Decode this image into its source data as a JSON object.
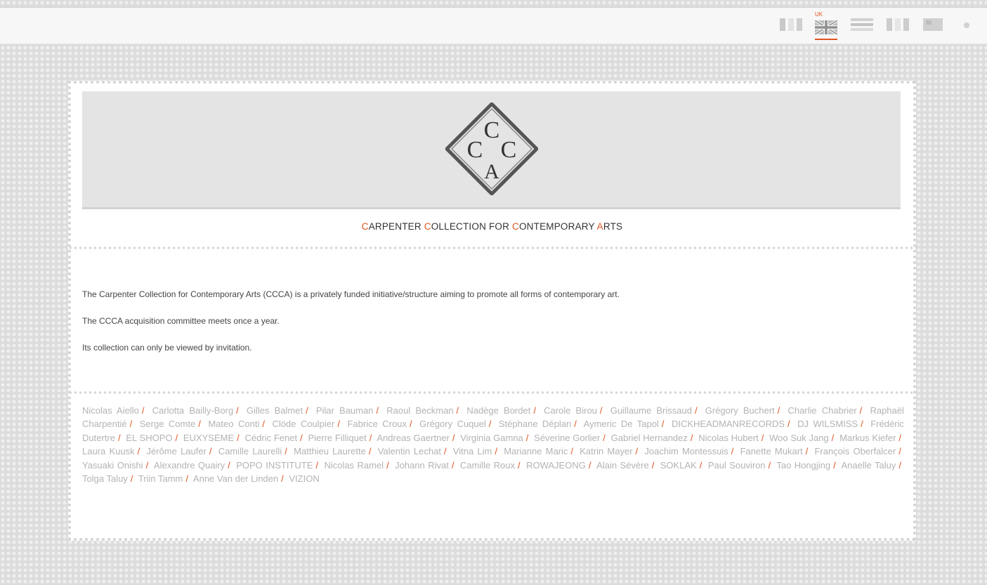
{
  "languages": {
    "active_code": "UK",
    "flags": [
      {
        "name": "france-flag"
      },
      {
        "name": "uk-flag",
        "active": true
      },
      {
        "name": "germany-flag"
      },
      {
        "name": "italy-flag"
      },
      {
        "name": "japan-flag"
      },
      {
        "name": "other-language-dot"
      }
    ],
    "accent_color": "#e0531f"
  },
  "brand": {
    "logo": "CCCA",
    "name_parts": [
      {
        "initial": "C",
        "rest": "ARPENTER "
      },
      {
        "initial": "C",
        "rest": "OLLECTION FOR "
      },
      {
        "initial": "C",
        "rest": "ONTEMPORARY "
      },
      {
        "initial": "A",
        "rest": "RTS"
      }
    ]
  },
  "intro": [
    "The Carpenter Collection for Contemporary Arts (CCCA) is a privately funded initiative/structure aiming to promote all forms of contemporary art.",
    "The CCCA acquisition committee meets once a year.",
    "Its collection can only be viewed by invitation."
  ],
  "artists": [
    "Nicolas Aiello",
    "Carlotta Bailly-Borg",
    "Gilles Balmet",
    "Pilar Bauman",
    "Raoul Beckman",
    "Nadège Bordet",
    "Carole Birou",
    "Guillaume Brissaud",
    "Grégory Buchert",
    "Charlie Chabrier",
    "Raphaël Charpentié",
    "Serge Comte",
    "Mateo Conti",
    "Clöde Coulpier",
    "Fabrice Croux",
    "Grégory Cuquel",
    "Stéphane Déplan",
    "Aymeric De Tapol",
    "DICKHEADMANRECORDS",
    "DJ WILSMISS",
    "Frédéric Dutertre",
    "EL SHOPO",
    "EUXYSEME",
    "Cédric Fenet",
    "Pierre Filliquet",
    "Andreas Gaertner",
    "Virginia Gamna",
    "Séverine Gorlier",
    "Gabriel Hernandez",
    "Nicolas Hubert",
    "Woo Suk Jang",
    "Markus Kiefer",
    "Laura Kuusk",
    "Jérôme Laufer",
    "Camille Laurelli",
    "Matthieu Laurette",
    "Valentin Lechat",
    "Vitna Lim",
    "Marianne Maric",
    "Katrin Mayer",
    "Joachim Montessuis",
    "Fanette Mukart",
    "François Oberfalcer",
    "Yasuaki Onishi",
    "Alexandre Quairy",
    "POPO INSTITUTE",
    "Nicolas Ramel",
    "Johann Rivat",
    "Camille Roux",
    "ROWAJEONG",
    "Alain Sévère",
    "SOKLAK",
    "Paul Souviron",
    "Tao Hongjing",
    "Anaelle Taluy",
    "Tolga Taluy",
    "Triin Tamm",
    "Anne Van der Linden",
    "VIZION"
  ]
}
